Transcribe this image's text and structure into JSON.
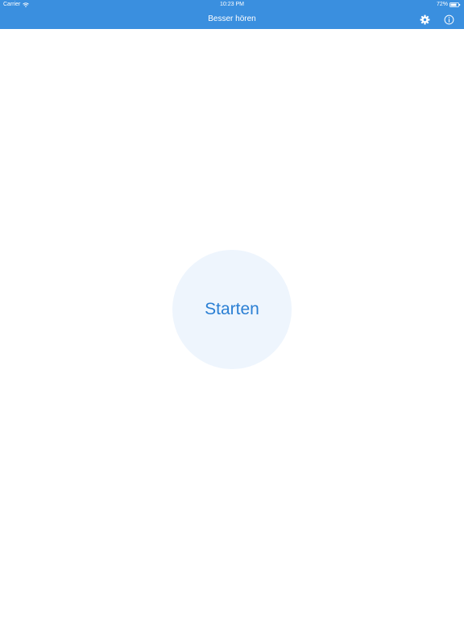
{
  "status_bar": {
    "carrier": "Carrier",
    "time": "10:23 PM",
    "battery": "72%"
  },
  "nav": {
    "title": "Besser hören",
    "right_icons": [
      "gear-icon",
      "info-icon"
    ]
  },
  "main": {
    "start_label": "Starten"
  },
  "colors": {
    "accent": "#3a8fdf",
    "button_background": "#eef5fd",
    "button_text": "#2a7fd4"
  }
}
